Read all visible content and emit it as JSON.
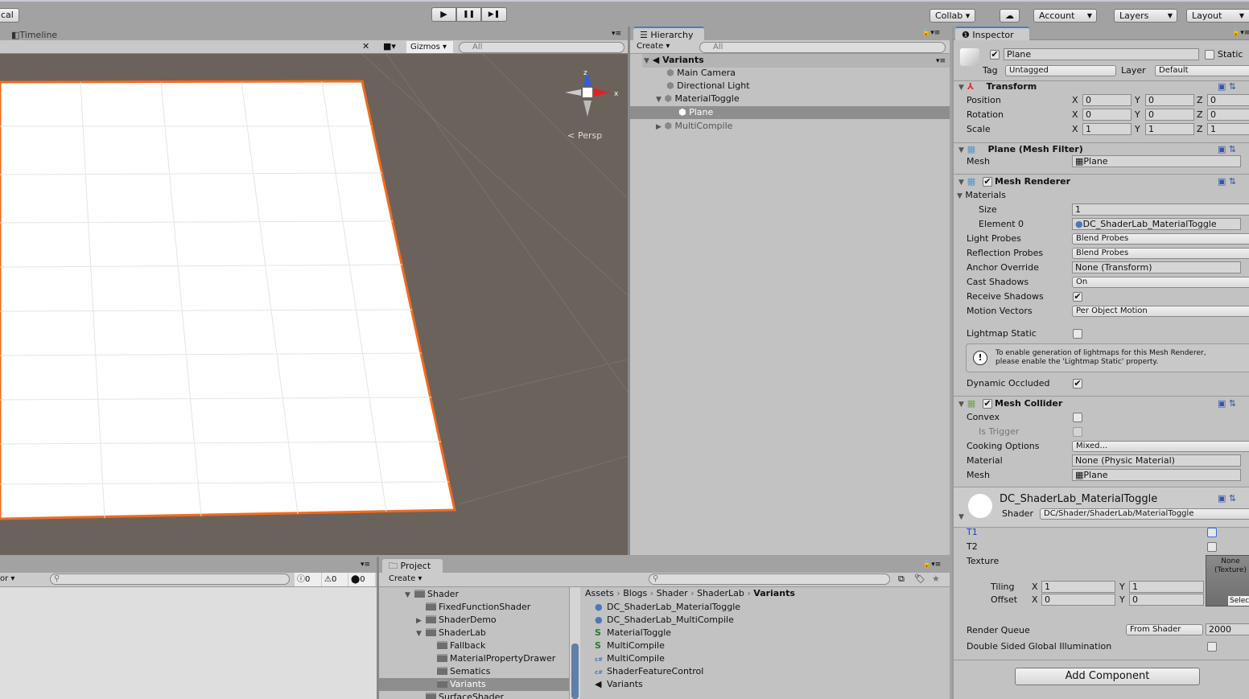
{
  "toolbar": {
    "local_label": "cal",
    "play": "▶",
    "pause": "❚❚",
    "step": "▶❚",
    "collab": "Collab ▾",
    "cloud": "☁",
    "account": "Account",
    "layers": "Layers",
    "layout": "Layout"
  },
  "scene": {
    "tab": "Timeline",
    "gizmos": "Gizmos",
    "search_placeholder": "All",
    "persp": "Persp",
    "axis_z": "z",
    "axis_x": "x",
    "colors": {
      "bg": "#6b625c",
      "plane": "#ffffff",
      "outline": "#f26b1d"
    }
  },
  "hierarchy": {
    "tab": "Hierarchy",
    "create": "Create",
    "search_placeholder": "All",
    "scene": "Variants",
    "items": [
      "Main Camera",
      "Directional Light",
      "MaterialToggle",
      "Plane",
      "MultiCompile"
    ]
  },
  "inspector": {
    "tab": "Inspector",
    "name": "Plane",
    "static": "Static",
    "tag_label": "Tag",
    "tag": "Untagged",
    "layer_label": "Layer",
    "layer": "Default",
    "transform": {
      "title": "Transform",
      "rows": [
        {
          "label": "Position",
          "x": "0",
          "y": "0",
          "z": "0"
        },
        {
          "label": "Rotation",
          "x": "0",
          "y": "0",
          "z": "0"
        },
        {
          "label": "Scale",
          "x": "1",
          "y": "1",
          "z": "1"
        }
      ]
    },
    "mesh_filter": {
      "title": "Plane (Mesh Filter)",
      "mesh_label": "Mesh",
      "mesh": "Plane"
    },
    "mesh_renderer": {
      "title": "Mesh Renderer",
      "materials": "Materials",
      "size_label": "Size",
      "size": "1",
      "element_label": "Element 0",
      "element": "DC_ShaderLab_MaterialToggle",
      "light_probes_label": "Light Probes",
      "light_probes": "Blend Probes",
      "reflection_label": "Reflection Probes",
      "reflection": "Blend Probes",
      "anchor_label": "Anchor Override",
      "anchor": "None (Transform)",
      "cast_label": "Cast Shadows",
      "cast": "On",
      "receive_label": "Receive Shadows",
      "motion_label": "Motion Vectors",
      "motion": "Per Object Motion",
      "lightmap_label": "Lightmap Static",
      "info": "To enable generation of lightmaps for this Mesh Renderer,\nplease enable the 'Lightmap Static' property.",
      "dynamic_label": "Dynamic Occluded"
    },
    "mesh_collider": {
      "title": "Mesh Collider",
      "convex": "Convex",
      "trigger": "Is Trigger",
      "cooking_label": "Cooking Options",
      "cooking": "Mixed...",
      "material_label": "Material",
      "material": "None (Physic Material)",
      "mesh_label": "Mesh",
      "mesh": "Plane"
    },
    "material": {
      "name": "DC_ShaderLab_MaterialToggle",
      "shader_label": "Shader",
      "shader": "DC/Shader/ShaderLab/MaterialToggle",
      "t1": "T1",
      "t2": "T2",
      "texture": "Texture",
      "tex_none": "None\n(Texture)",
      "select": "Select",
      "tiling": "Tiling",
      "offset": "Offset",
      "tiling_x": "1",
      "tiling_y": "1",
      "offset_x": "0",
      "offset_y": "0",
      "render_queue_label": "Render Queue",
      "render_queue_mode": "From Shader",
      "render_queue": "2000",
      "dsgi": "Double Sided Global Illumination"
    },
    "add_component": "Add Component"
  },
  "console": {
    "filter": "or",
    "errors_info": "0",
    "warnings": "0",
    "errors": "0"
  },
  "project": {
    "tab": "Project",
    "create": "Create",
    "tree": [
      {
        "label": "Shader",
        "depth": 0,
        "arrow": "▼"
      },
      {
        "label": "FixedFunctionShader",
        "depth": 1,
        "arrow": ""
      },
      {
        "label": "ShaderDemo",
        "depth": 1,
        "arrow": "▶"
      },
      {
        "label": "ShaderLab",
        "depth": 1,
        "arrow": "▼"
      },
      {
        "label": "Fallback",
        "depth": 2,
        "arrow": ""
      },
      {
        "label": "MaterialPropertyDrawer",
        "depth": 2,
        "arrow": ""
      },
      {
        "label": "Sematics",
        "depth": 2,
        "arrow": ""
      },
      {
        "label": "Variants",
        "depth": 2,
        "arrow": ""
      },
      {
        "label": "SurfaceShader",
        "depth": 1,
        "arrow": ""
      }
    ],
    "breadcrumb": [
      "Assets",
      "Blogs",
      "Shader",
      "ShaderLab",
      "Variants"
    ],
    "files": [
      {
        "name": "DC_ShaderLab_MaterialToggle",
        "icon": "material"
      },
      {
        "name": "DC_ShaderLab_MultiCompile",
        "icon": "material"
      },
      {
        "name": "MaterialToggle",
        "icon": "shader"
      },
      {
        "name": "MultiCompile",
        "icon": "shader"
      },
      {
        "name": "MultiCompile",
        "icon": "cs"
      },
      {
        "name": "ShaderFeatureControl",
        "icon": "cs"
      },
      {
        "name": "Variants",
        "icon": "unity"
      }
    ]
  }
}
